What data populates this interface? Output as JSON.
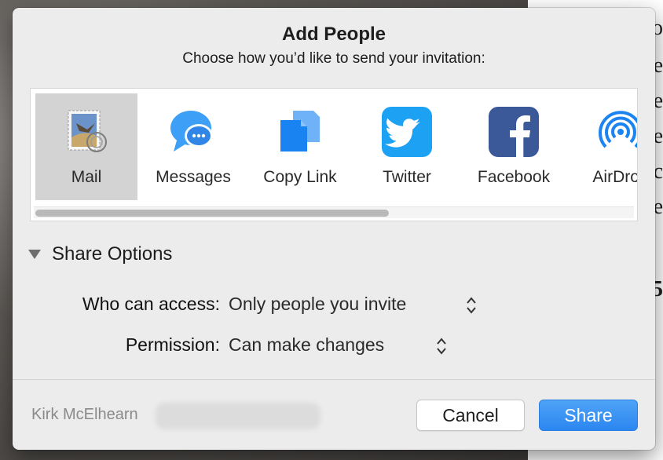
{
  "dialog": {
    "title": "Add People",
    "subtitle": "Choose how you’d like to send your invitation:"
  },
  "services": [
    {
      "label": "Mail",
      "icon": "mail-stamp-icon",
      "selected": true
    },
    {
      "label": "Messages",
      "icon": "messages-bubble-icon",
      "selected": false
    },
    {
      "label": "Copy Link",
      "icon": "copy-link-icon",
      "selected": false
    },
    {
      "label": "Twitter",
      "icon": "twitter-bird-icon",
      "selected": false
    },
    {
      "label": "Facebook",
      "icon": "facebook-f-icon",
      "selected": false
    },
    {
      "label": "AirDrop",
      "icon": "airdrop-icon",
      "selected": false
    }
  ],
  "share_options": {
    "heading": "Share Options",
    "who_label": "Who can access:",
    "who_value": "Only people you invite",
    "permission_label": "Permission:",
    "permission_value": "Can make changes"
  },
  "footer": {
    "account_name": "Kirk McElhearn",
    "cancel_label": "Cancel",
    "share_label": "Share"
  },
  "colors": {
    "accent": "#2b86f0",
    "twitter": "#1da1f2",
    "facebook": "#3b5998",
    "airdrop": "#1b84f0"
  }
}
